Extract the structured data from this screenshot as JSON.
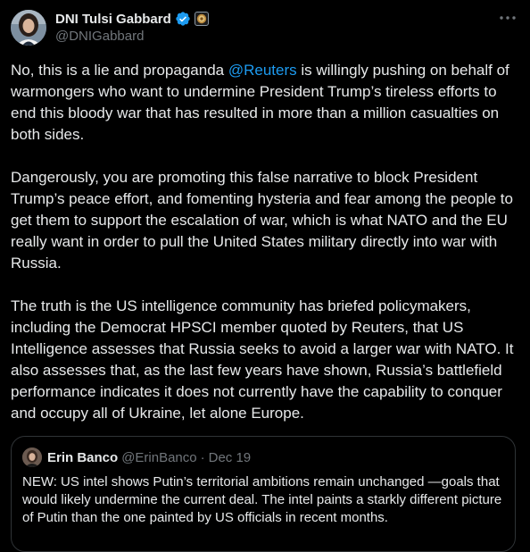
{
  "author": {
    "display_name": "DNI Tulsi Gabbard",
    "handle": "@DNIGabbard",
    "verified_icon": "verified-checkmark-icon",
    "affiliation_icon": "government-seal-badge-icon"
  },
  "menu": {
    "more_icon": "more-horizontal-icon",
    "more_label": "···"
  },
  "tweet": {
    "paragraph_1": {
      "before": "No, this is a lie and propaganda ",
      "mention": "@Reuters",
      "after": " is willingly pushing on behalf of warmongers who want to undermine President Trump’s tireless efforts to end this bloody war that has resulted in more than a million casualties on both sides."
    },
    "paragraph_2": "Dangerously, you are promoting this false narrative to block President Trump’s peace effort, and fomenting hysteria and fear among the people to get them to support the escalation of war, which is what NATO and the EU really want in order to pull the United States military directly into war with Russia.",
    "paragraph_3": "The truth is the US intelligence community has briefed policymakers, including the Democrat HPSCI member quoted by Reuters, that US Intelligence assesses that Russia seeks to avoid a larger war with NATO. It also assesses that, as the last few years have shown, Russia’s battlefield performance indicates it does not currently have the capability to conquer and occupy all of Ukraine, let alone Europe."
  },
  "quote": {
    "display_name": "Erin Banco",
    "handle": "@ErinBanco",
    "separator": "·",
    "date": "Dec 19",
    "text": "NEW: US intel shows Putin’s territorial ambitions remain unchanged —goals that would likely undermine the current deal. The intel paints a starkly different picture of Putin than the one painted by US officials in recent months."
  },
  "colors": {
    "background": "#000000",
    "text": "#e7e9ea",
    "secondary": "#71767b",
    "link": "#1d9bf0",
    "verified": "#1d9bf0",
    "border": "#2f3336"
  }
}
